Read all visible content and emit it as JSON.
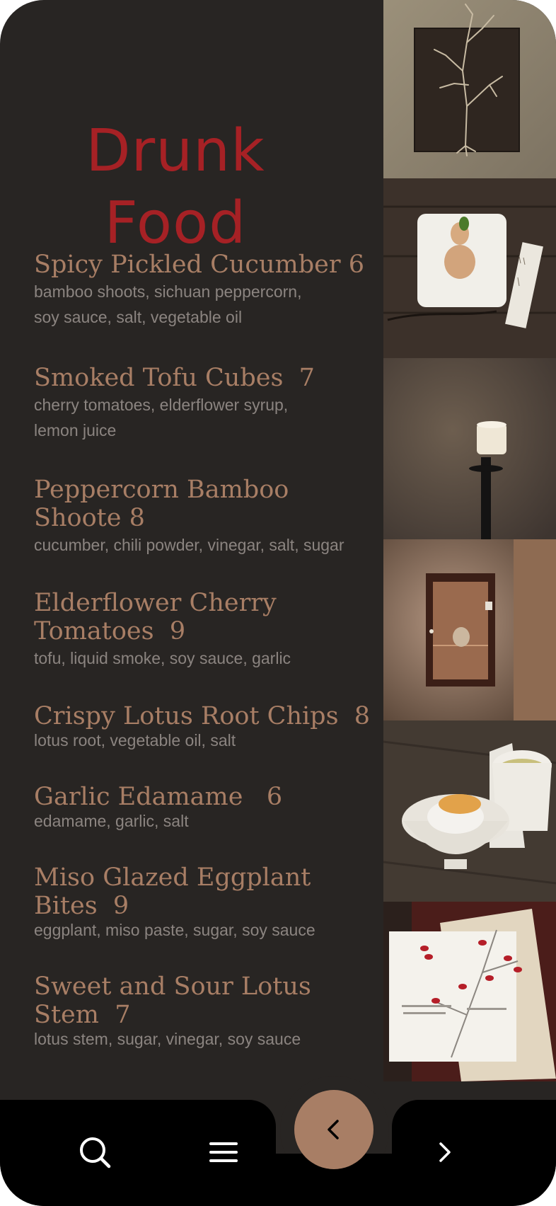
{
  "title": {
    "line1": "Drunk",
    "line2": "Food"
  },
  "menu": [
    {
      "name": "Spicy Pickled Cucumber 6",
      "desc": "bamboo shoots, sichuan peppercorn,\nsoy sauce, salt, vegetable oil"
    },
    {
      "name": "Smoked Tofu Cubes  7",
      "desc": "cherry tomatoes, elderflower syrup,\nlemon juice"
    },
    {
      "name": "Peppercorn Bamboo\nShoote 8",
      "desc": "cucumber, chili powder, vinegar, salt, sugar"
    },
    {
      "name": "Elderflower Cherry\nTomatoes  9",
      "desc": "tofu, liquid smoke, soy sauce, garlic"
    },
    {
      "name": "Crispy Lotus Root Chips  8",
      "desc": "lotus root, vegetable oil, salt"
    },
    {
      "name": "Garlic Edamame   6",
      "desc": "edamame, garlic, salt"
    },
    {
      "name": "Miso Glazed Eggplant\nBites  9",
      "desc": "eggplant, miso paste, sugar, soy sauce"
    },
    {
      "name": "Sweet and Sour Lotus\nStem  7",
      "desc": "lotus stem, sugar, vinegar, soy sauce"
    }
  ],
  "nav": {
    "icons": [
      "search-icon",
      "menu-icon",
      "back-icon",
      "forward-icon"
    ]
  },
  "colors": {
    "background": "#282523",
    "title": "#a62125",
    "item_name": "#a87e65",
    "item_desc": "#8b8480",
    "accent": "#a87e65",
    "navbar": "#000000"
  }
}
